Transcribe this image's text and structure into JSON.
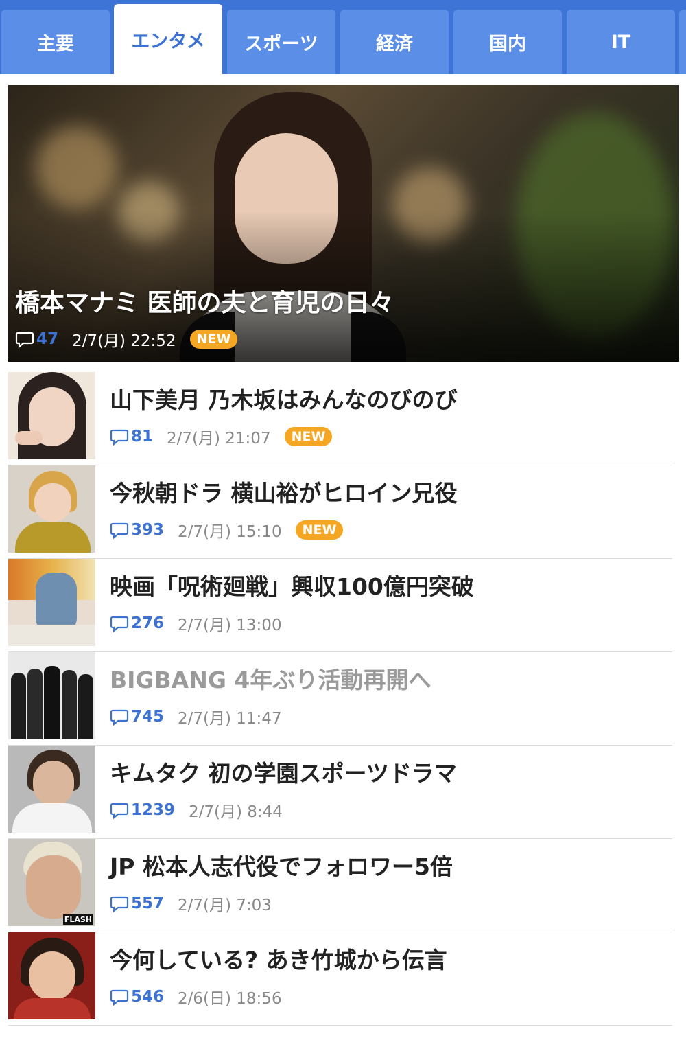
{
  "tabs": [
    {
      "label": "主要"
    },
    {
      "label": "エンタメ"
    },
    {
      "label": "スポーツ"
    },
    {
      "label": "経済"
    },
    {
      "label": "国内"
    },
    {
      "label": "IT"
    }
  ],
  "active_tab": "エンタメ",
  "colors": {
    "tab_bar": "#3d74d6",
    "tab": "#5b8ee6",
    "accent": "#3b72d4",
    "badge": "#f5a623"
  },
  "hero": {
    "title": "橋本マナミ 医師の夫と育児の日々",
    "comments": "47",
    "date": "2/7(月) 22:52",
    "badge": "NEW"
  },
  "articles": [
    {
      "title": "山下美月 乃木坂はみんなのびのび",
      "comments": "81",
      "date": "2/7(月) 21:07",
      "badge": "NEW"
    },
    {
      "title": "今秋朝ドラ 横山裕がヒロイン兄役",
      "comments": "393",
      "date": "2/7(月) 15:10",
      "badge": "NEW"
    },
    {
      "title": "映画「呪術廻戦」興収100億円突破",
      "comments": "276",
      "date": "2/7(月) 13:00"
    },
    {
      "title": "BIGBANG 4年ぶり活動再開へ",
      "comments": "745",
      "date": "2/7(月) 11:47",
      "read": true
    },
    {
      "title": "キムタク 初の学園スポーツドラマ",
      "comments": "1239",
      "date": "2/7(月) 8:44"
    },
    {
      "title": "JP 松本人志代役でフォロワー5倍",
      "comments": "557",
      "date": "2/7(月) 7:03",
      "thumb_label": "FLASH"
    },
    {
      "title": "今何している? あき竹城から伝言",
      "comments": "546",
      "date": "2/6(日) 18:56"
    }
  ]
}
